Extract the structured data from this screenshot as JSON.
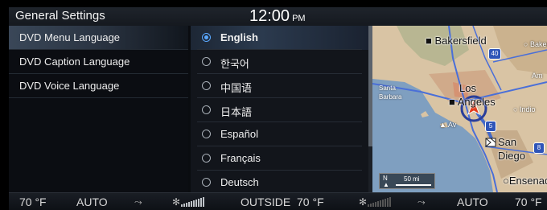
{
  "header": {
    "title": "General Settings",
    "time": "12:00",
    "ampm": "PM"
  },
  "menu": {
    "items": [
      {
        "label": "DVD Menu Language",
        "active": true
      },
      {
        "label": "DVD Caption Language",
        "active": false
      },
      {
        "label": "DVD Voice Language",
        "active": false
      }
    ]
  },
  "options": {
    "items": [
      {
        "label": "English",
        "selected": true
      },
      {
        "label": "한국어",
        "selected": false
      },
      {
        "label": "中国语",
        "selected": false
      },
      {
        "label": "日本語",
        "selected": false
      },
      {
        "label": "Español",
        "selected": false
      },
      {
        "label": "Français",
        "selected": false
      },
      {
        "label": "Deutsch",
        "selected": false
      }
    ]
  },
  "map": {
    "cities": {
      "bakersfield": "Bakersfield",
      "baker": "Baker",
      "santa_barbara": "Santa\nBarbara",
      "los_angeles_1": "Los",
      "los_angeles_2": "Angeles",
      "indio": "Indio",
      "san_diego_1": "San",
      "san_diego_2": "Diego",
      "ensenada": "Ensenad",
      "am": "Am",
      "av": "Av"
    },
    "highways": {
      "h40": "40",
      "h5": "5",
      "h8": "8"
    },
    "scale": {
      "north": "N",
      "distance": "50 mi"
    }
  },
  "climate": {
    "left_temp": "70 °F",
    "left_mode": "AUTO",
    "outside_label": "OUTSIDE",
    "outside_temp": "70 °F",
    "right_mode": "AUTO",
    "right_temp": "70 °F"
  },
  "colors": {
    "accent": "#5aa8ff",
    "ocean": "#7f9fc0",
    "land": "#d9c4a4"
  }
}
